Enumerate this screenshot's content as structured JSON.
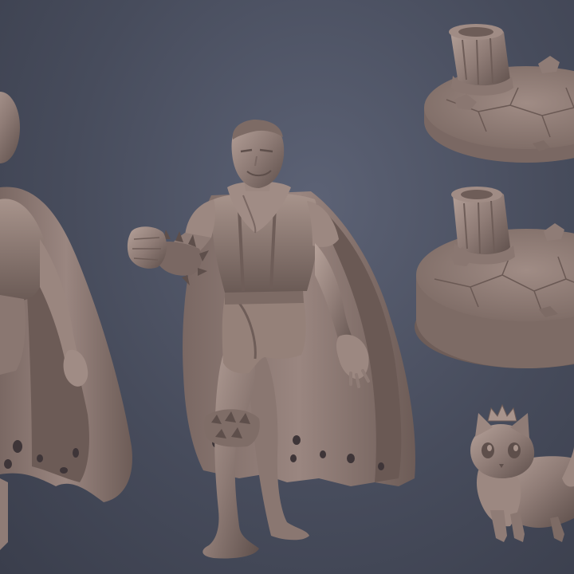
{
  "scene": {
    "background": "#4a4f5f",
    "clay_color": "#8f7c76",
    "clay_shadow": "#5e4f4b",
    "clay_highlight": "#b8a49c"
  },
  "figures": {
    "hero_back": "hero-back-view",
    "hero_front": "hero-front-view",
    "base_top": "ruined-pillar-base",
    "base_bottom": "ruined-pillar-base-variant",
    "cat": "crowned-cat-companion"
  }
}
